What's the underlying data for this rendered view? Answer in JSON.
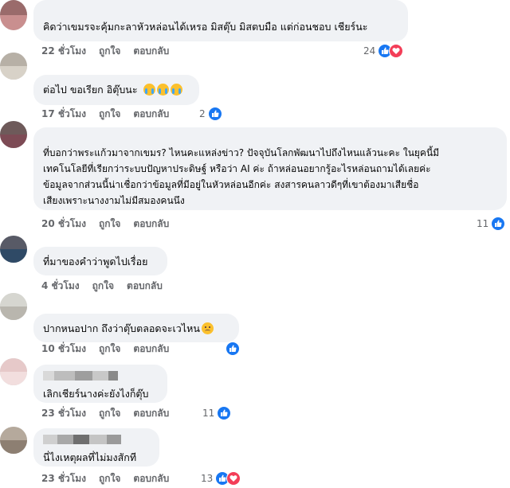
{
  "actions": {
    "like": "ถูกใจ",
    "reply": "ตอบกลับ"
  },
  "comments": [
    {
      "text": "คิดว่าเขมรจะคุ้มกะลาหัวหล่อนได้เหรอ มิสตุ๊บ มิสตบมือ แต่ก่อนชอบ เชียร์นะ",
      "time": "22 ชั่วโมง",
      "reaction_count": "24",
      "reactions": [
        "like",
        "love"
      ]
    },
    {
      "text": "ต่อไป ขอเรียก อิตุ๊บนะ",
      "emojis": [
        "cry",
        "cry",
        "cry"
      ],
      "time": "17 ชั่วโมง",
      "reaction_count": "2",
      "reactions": [
        "like"
      ]
    },
    {
      "text": "ที่บอกว่าพระแก้วมาจากเขมร? ไหนคะแหล่งข่าว? ปัจจุบันโลกพัฒนาไปถึงไหนแล้วนะคะ ในยุคนี้มี\nเทคโนโลยีที่เรียกว่าระบบปัญหาประดิษฐ์ หรือว่า AI ค่ะ ถ้าหล่อนอยากรู้อะไรหล่อนถามได้เลยค่ะ\nข้อมูลจากส่วนนี้น่าเชื่อกว่าข้อมูลที่มีอยู่ในหัวหล่อนอีกค่ะ สงสารคนลาวดีๆที่เขาต้องมาเสียชื่อ\nเสียงเพราะนางงามไม่มีสมองคนนึง",
      "time": "20 ชั่วโมง",
      "reaction_count": "11",
      "reactions": [
        "like"
      ]
    },
    {
      "text": "ที่มาของคำว่าพูดไปเรื่อย",
      "time": "4 ชั่วโมง",
      "reaction_count": "",
      "reactions": []
    },
    {
      "text": "ปากหนอปาก ถึงว่าตุ๊บตลอดจะเวไหน",
      "emojis": [
        "sad"
      ],
      "time": "10 ชั่วโมง",
      "reaction_count": "",
      "reactions": [
        "like"
      ]
    },
    {
      "text": "เลิกเชียร์นางค่ะยังไงก็ตุ๊บ",
      "time": "23 ชั่วโมง",
      "reaction_count": "11",
      "reactions": [
        "like"
      ]
    },
    {
      "text": "นี่ไงเหตุผลที่ไม่มงสักที",
      "time": "23 ชั่วโมง",
      "reaction_count": "13",
      "reactions": [
        "like",
        "love"
      ]
    }
  ],
  "colors": {
    "bubble_bg": "#f0f2f5",
    "meta_text": "#65676b",
    "like_blue": "#1877f2",
    "love_red": "#f33e58"
  }
}
